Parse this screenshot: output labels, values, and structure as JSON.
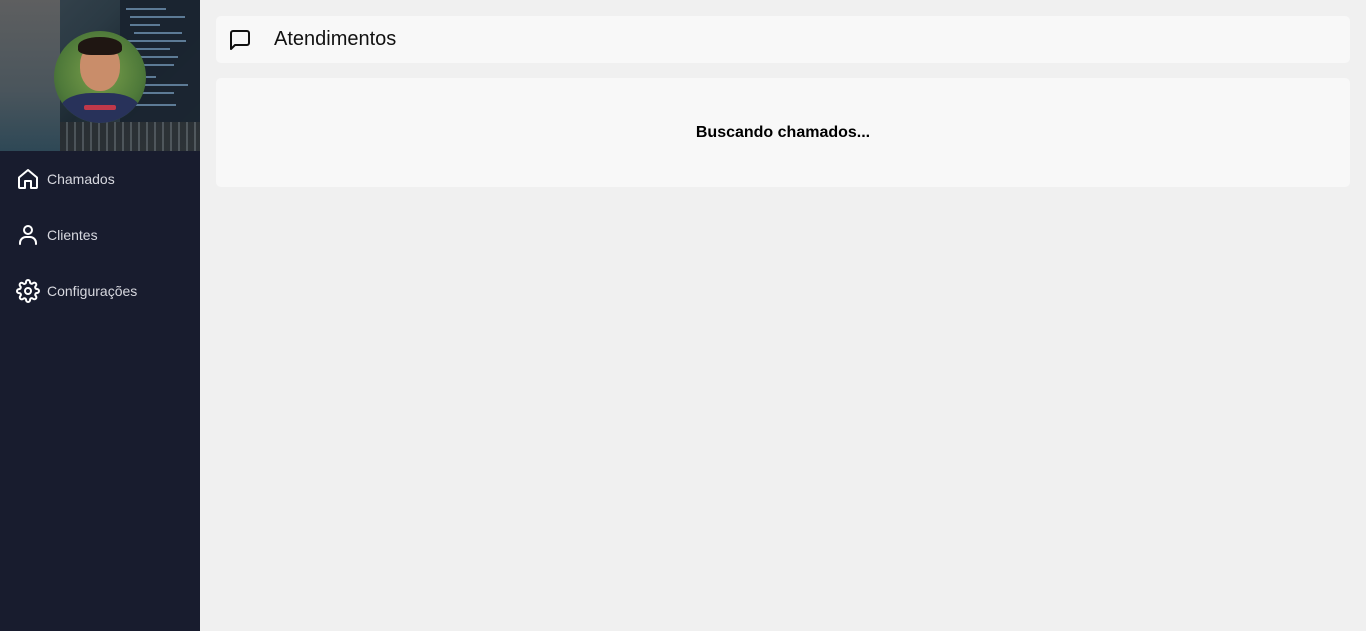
{
  "sidebar": {
    "avatar_alt": "avatar",
    "items": [
      {
        "label": "Chamados",
        "icon": "home-icon"
      },
      {
        "label": "Clientes",
        "icon": "user-icon"
      },
      {
        "label": "Configurações",
        "icon": "gear-icon"
      }
    ],
    "colors": {
      "background": "#181c2e",
      "text": "#d7d8df"
    }
  },
  "header": {
    "title": "Atendimentos",
    "icon": "message-square-icon"
  },
  "content": {
    "status_text": "Buscando chamados..."
  },
  "colors": {
    "page_background": "#f0f0f0",
    "card_background": "#f8f8f8"
  }
}
